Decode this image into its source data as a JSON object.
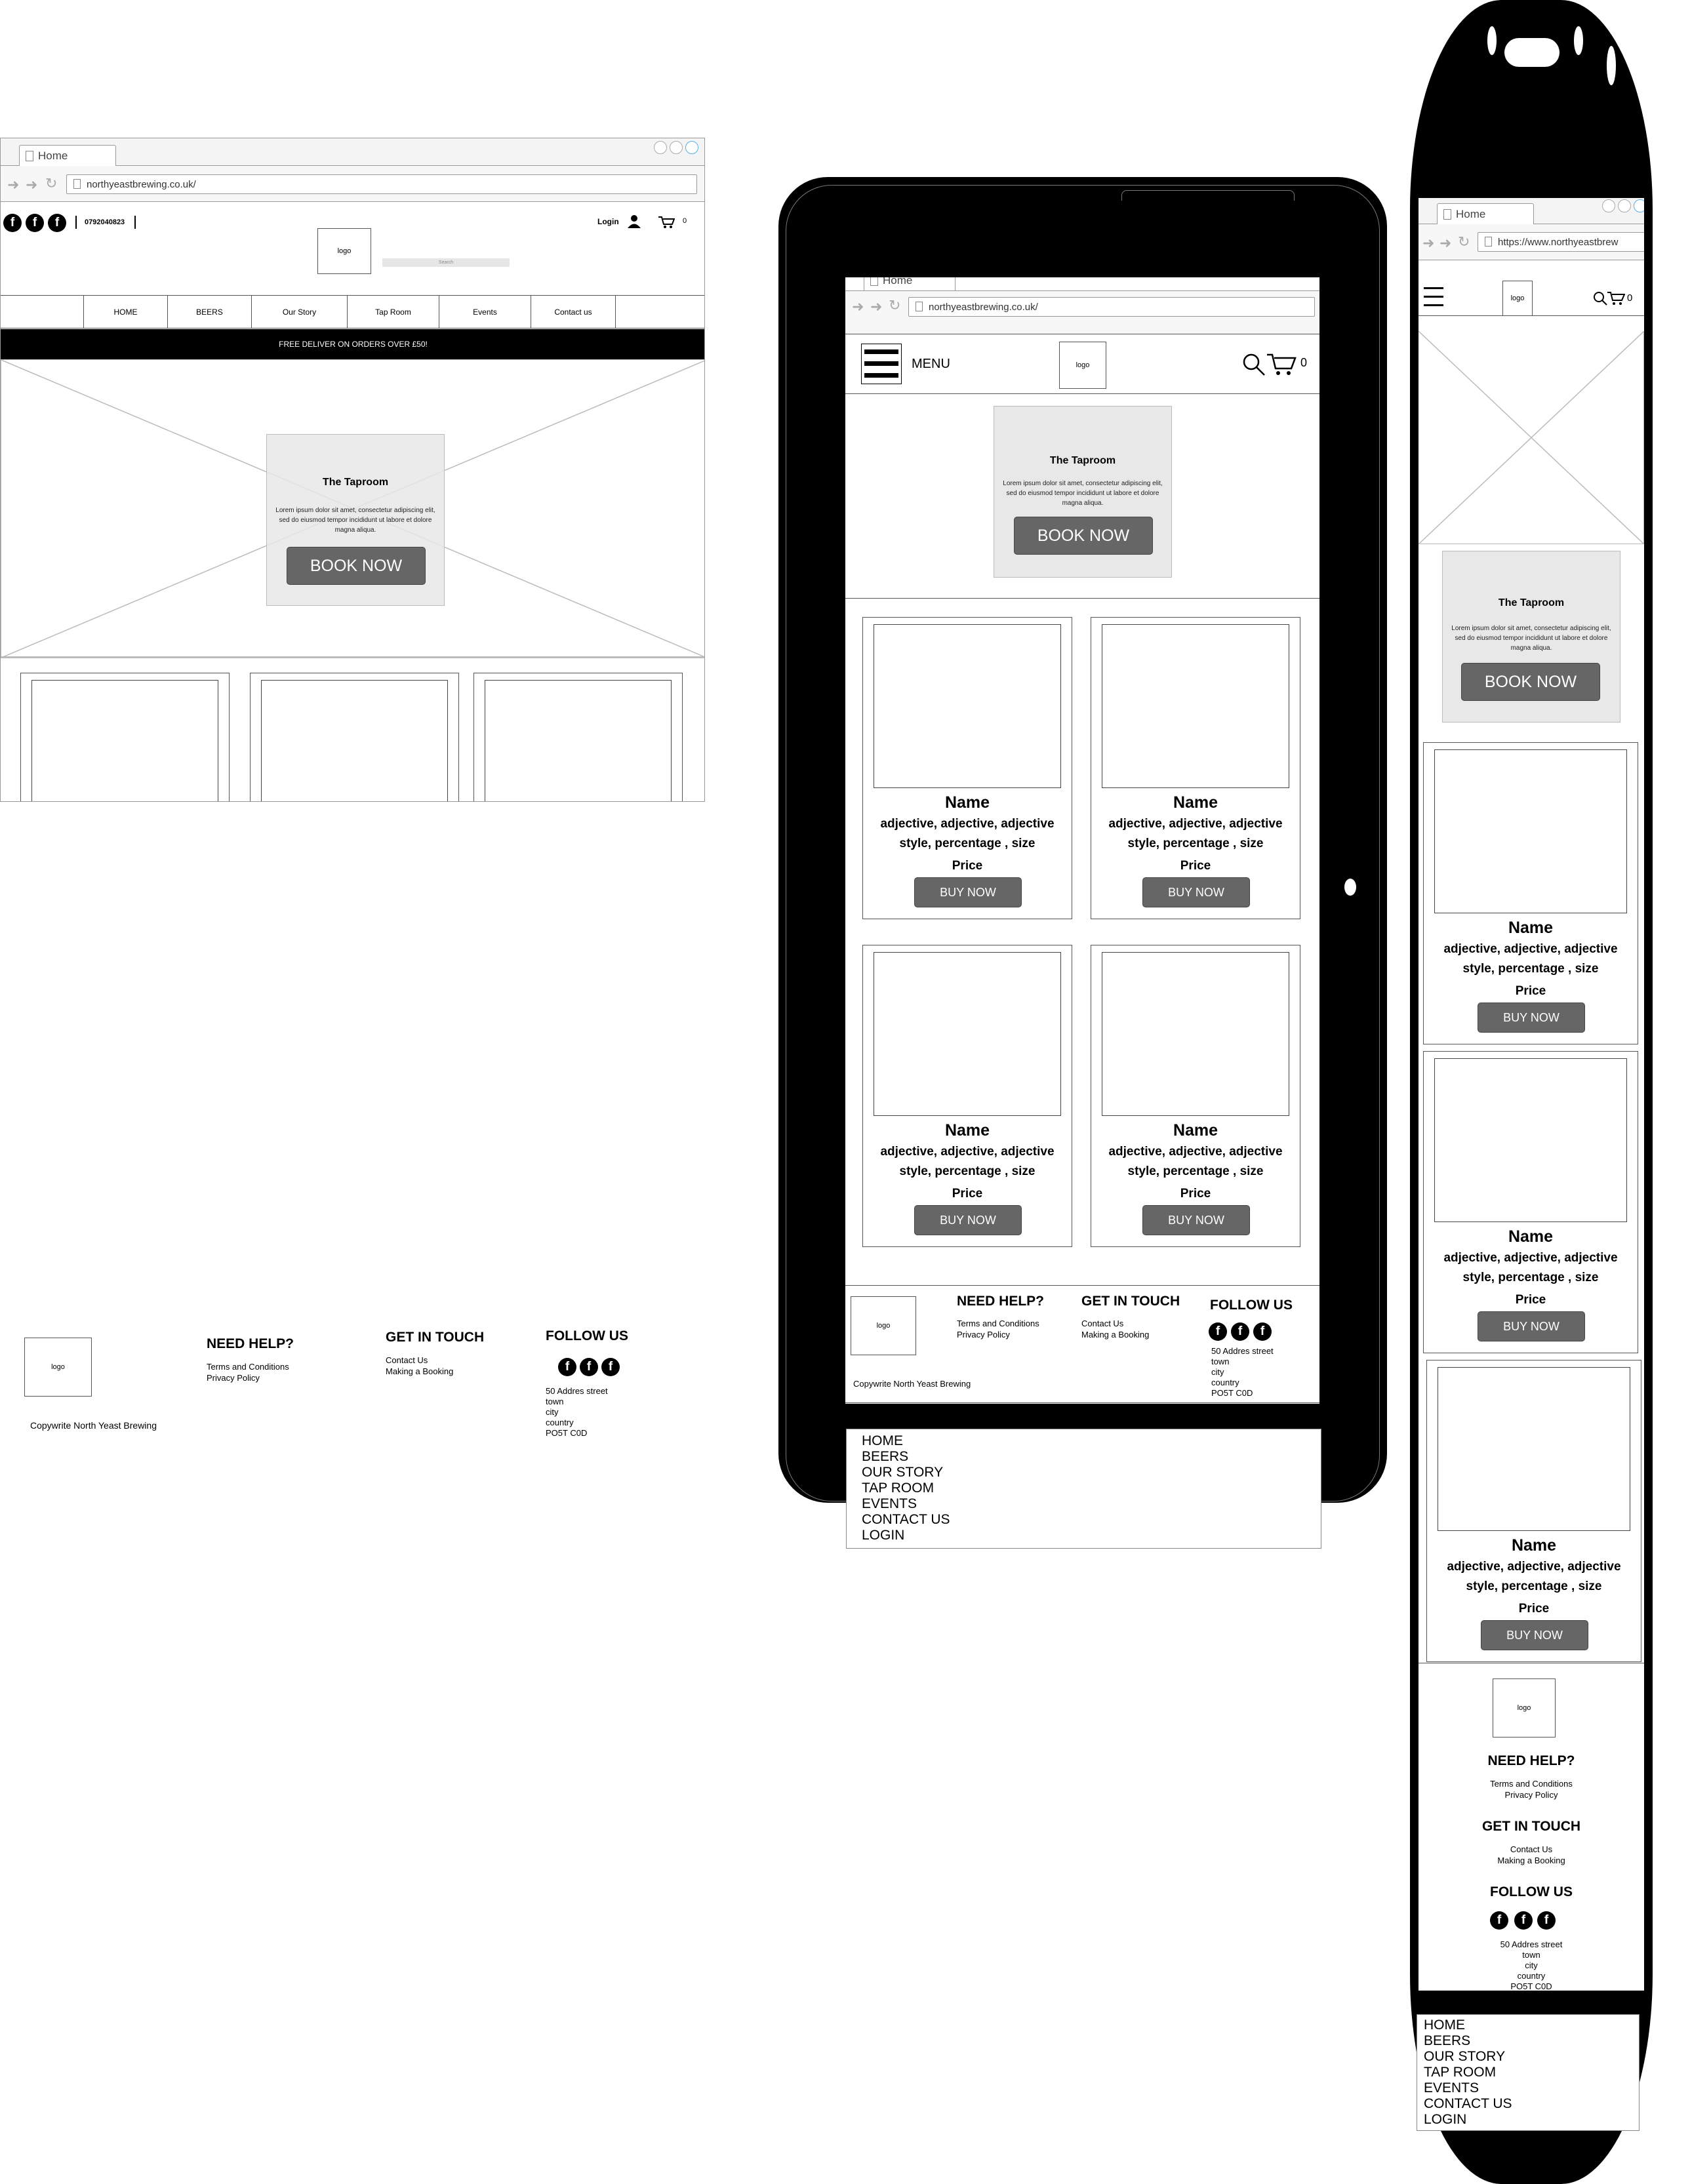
{
  "desktop": {
    "tab_title": "Home",
    "url": "northyeastbrewing.co.uk/",
    "phone": "0792040823",
    "login_label": "Login",
    "cart_count": "0",
    "logo_text": "logo",
    "search_placeholder": "Search",
    "nav": [
      "HOME",
      "BEERS",
      "Our Story",
      "Tap Room",
      "Events",
      "Contact us"
    ],
    "banner": "FREE DELIVER ON ORDERS OVER £50!",
    "promo": {
      "title": "The Taproom",
      "body": "Lorem ipsum dolor sit amet, consectetur adipiscing elit, sed do eiusmod tempor incididunt ut labore et dolore magna aliqua.",
      "button": "BOOK NOW"
    }
  },
  "tablet": {
    "tab_title": "Home",
    "url": "northyeastbrewing.co.uk/",
    "menu_label": "MENU",
    "cart_count": "0",
    "logo_text": "logo"
  },
  "mobile": {
    "tab_title": "Home",
    "url": "https://www.northyeastbrew",
    "cart_count": "0",
    "logo_text": "logo"
  },
  "product": {
    "name": "Name",
    "desc1": "adjective, adjective, adjective",
    "desc2": "style, percentage , size",
    "price": "Price",
    "button": "BUY NOW"
  },
  "footer": {
    "need_help": "NEED HELP?",
    "terms": "Terms and Conditions",
    "privacy": "Privacy Policy",
    "get_in_touch": "GET IN TOUCH",
    "contact": "Contact Us",
    "booking": "Making a Booking",
    "follow_us": "FOLLOW US",
    "address": [
      "50 Addres street",
      "town",
      "city",
      "country",
      "PO5T C0D"
    ],
    "copyright": "Copywrite North Yeast Brewing"
  },
  "mobile_menu": [
    "HOME",
    "BEERS",
    "OUR STORY",
    "TAP ROOM",
    "EVENTS",
    "CONTACT US",
    "LOGIN"
  ],
  "icons": {
    "social": "facebook-icon",
    "social_glyph": "f",
    "user": "user-icon",
    "cart": "cart-icon",
    "search": "search-icon",
    "hamburger": "hamburger-menu-icon"
  }
}
